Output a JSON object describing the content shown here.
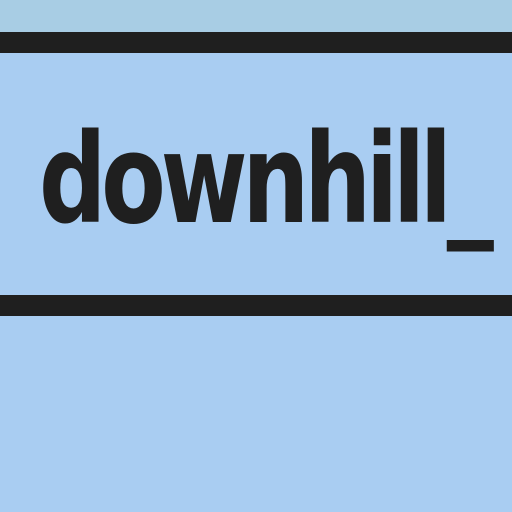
{
  "diagram_node": {
    "label": "downhill_",
    "colors": {
      "fill": "#a9cdf2",
      "border": "#1f1f1f",
      "text": "#1f1f1f",
      "top_strip": "#a8cde4"
    }
  }
}
